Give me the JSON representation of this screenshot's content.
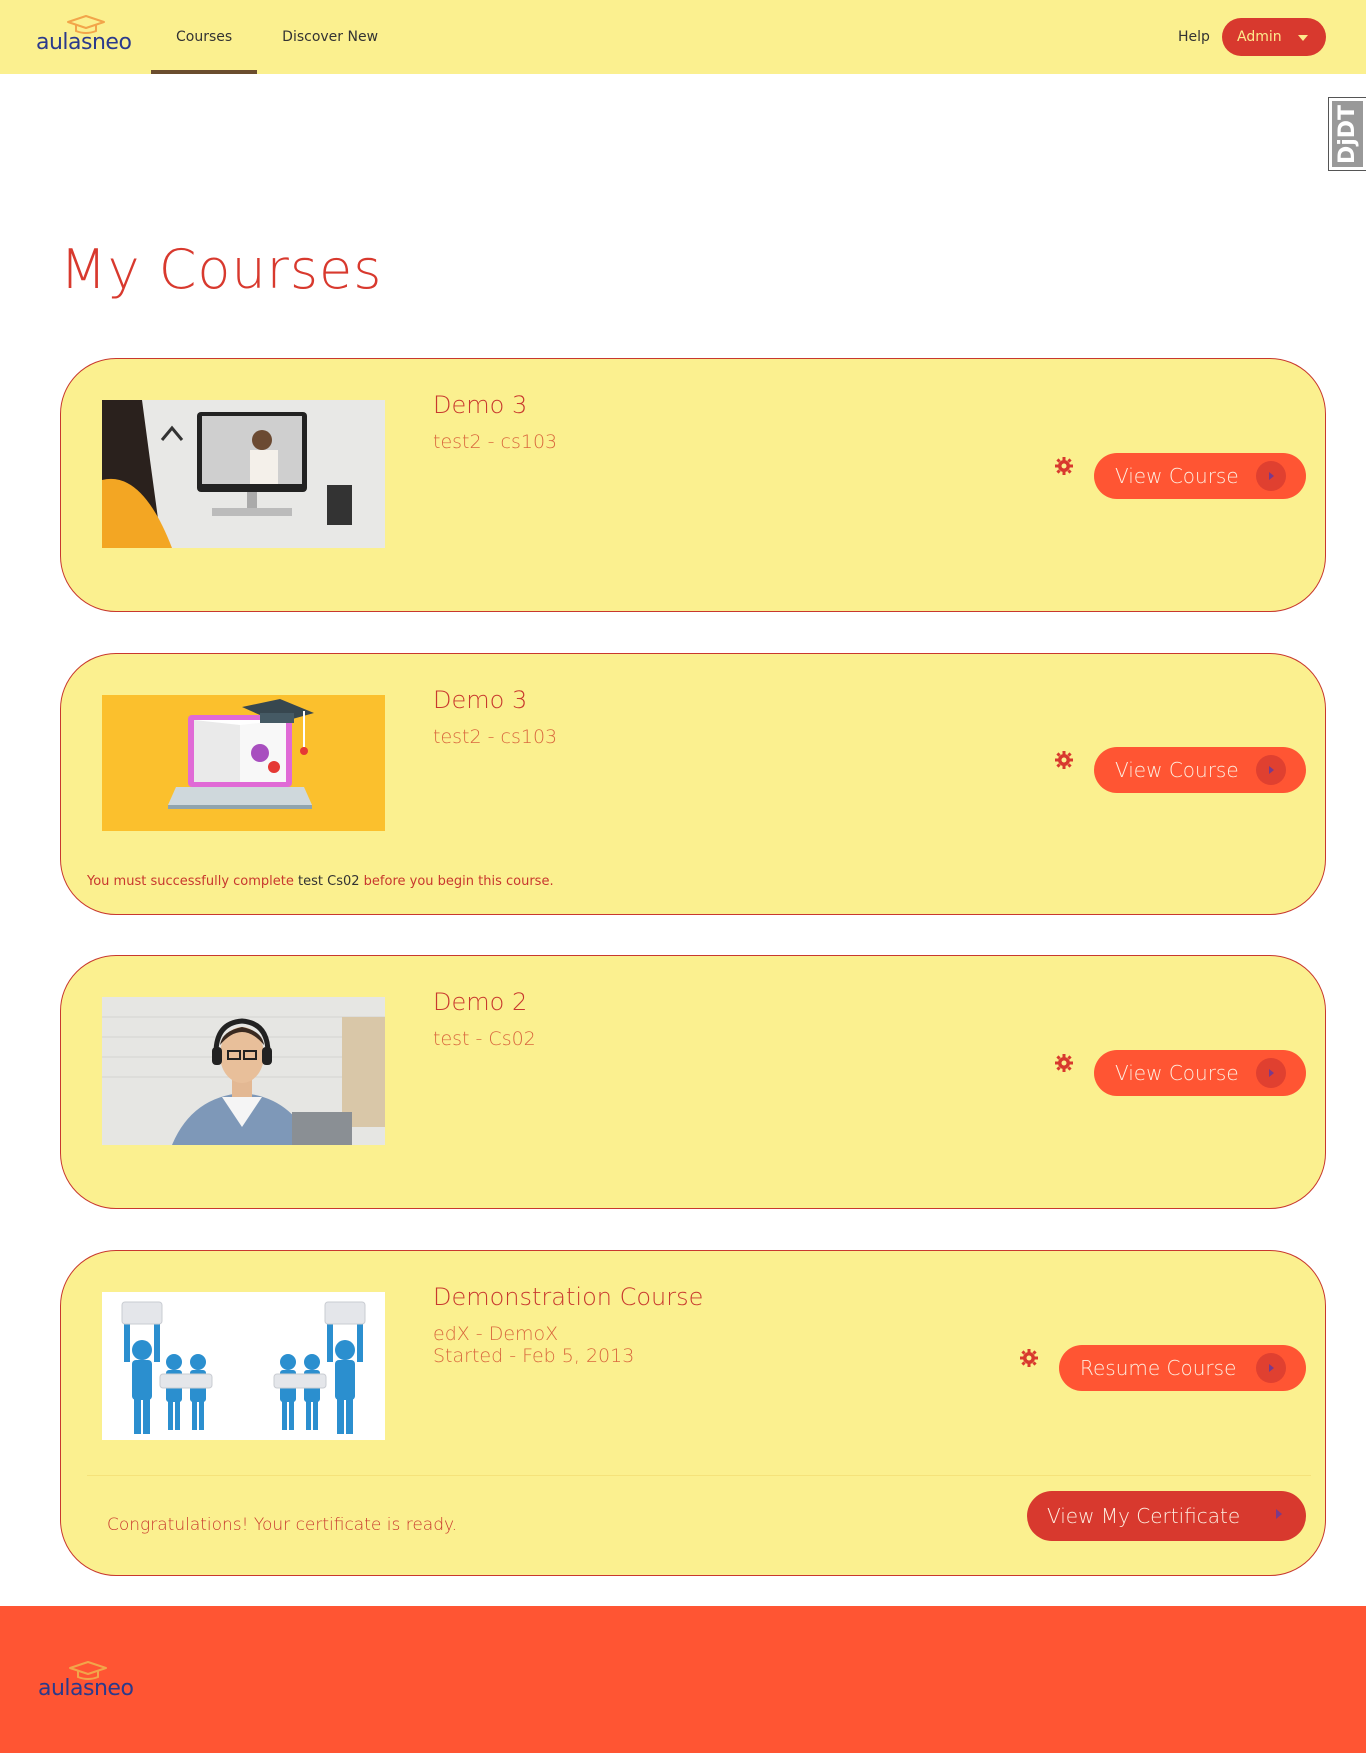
{
  "brand": {
    "name": "aulasneo"
  },
  "nav": {
    "items": [
      {
        "label": "Courses",
        "active": true
      },
      {
        "label": "Discover New",
        "active": false
      }
    ],
    "help_label": "Help",
    "user_label": "Admin"
  },
  "debug_toolbar": {
    "label": "DjDT"
  },
  "page": {
    "title": "My Courses"
  },
  "courses": [
    {
      "title": "Demo 3",
      "code": "test2 - cs103",
      "image": "woman-video-call-photo",
      "button_label": "View Course"
    },
    {
      "title": "Demo 3",
      "code": "test2 - cs103",
      "image": "laptop-graduation-cap-illustration",
      "button_label": "View Course",
      "prereq": {
        "before": "You must successfully complete",
        "link": "test Cs02",
        "after": "before you begin this course."
      }
    },
    {
      "title": "Demo 2",
      "code": "test - Cs02",
      "image": "man-headphones-photo",
      "button_label": "View Course"
    },
    {
      "title": "Demonstration Course",
      "code": "edX - DemoX",
      "started": "Started - Feb 5, 2013",
      "image": "puzzle-people-illustration",
      "button_label": "Resume Course",
      "certificate": {
        "message": "Congratulations! Your certificate is ready.",
        "button_label": "View My Certificate"
      }
    }
  ],
  "colors": {
    "header_bg": "#fbf08f",
    "card_bg": "#fbf08f",
    "accent": "#d8392e",
    "button": "#ff5533",
    "footer_bg": "#ff5533",
    "logo_text": "#2b3a8c"
  },
  "icons": [
    "graduation-cap-icon",
    "gear-icon",
    "chevron-right-icon",
    "caret-down-icon"
  ]
}
